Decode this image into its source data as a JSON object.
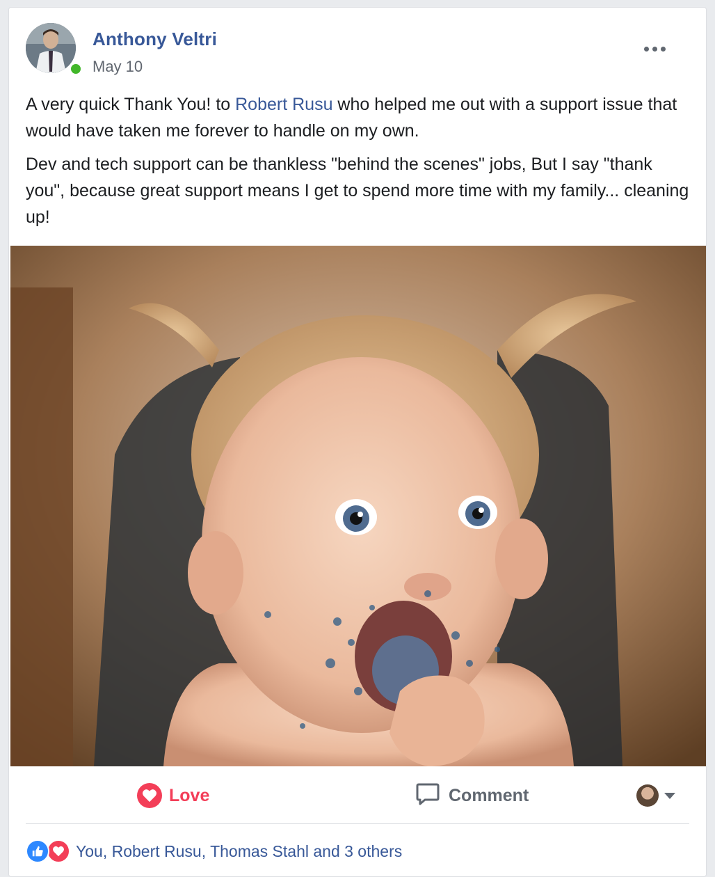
{
  "post": {
    "author": "Anthony Veltri",
    "timestamp": "May 10",
    "paragraph1_before": "A very quick Thank You! to ",
    "mention": "Robert Rusu",
    "paragraph1_after": " who helped me out with a support issue that would have taken me forever to handle on my own.",
    "paragraph2": "Dev and tech support can be thankless \"behind the scenes\" jobs, But I say \"thank you\", because great support means I get to spend more time with my family... cleaning up!"
  },
  "actions": {
    "love_label": "Love",
    "comment_label": "Comment"
  },
  "reactions": {
    "summary": "You, Robert Rusu, Thomas Stahl and 3 others"
  },
  "colors": {
    "link_blue": "#385898",
    "love_red": "#f33e58",
    "like_blue": "#2d88ff",
    "online_green": "#42b72a"
  },
  "icons": [
    "more-options-icon",
    "heart-icon",
    "comment-bubble-icon",
    "caret-down-icon",
    "like-thumb-icon",
    "love-heart-icon"
  ]
}
